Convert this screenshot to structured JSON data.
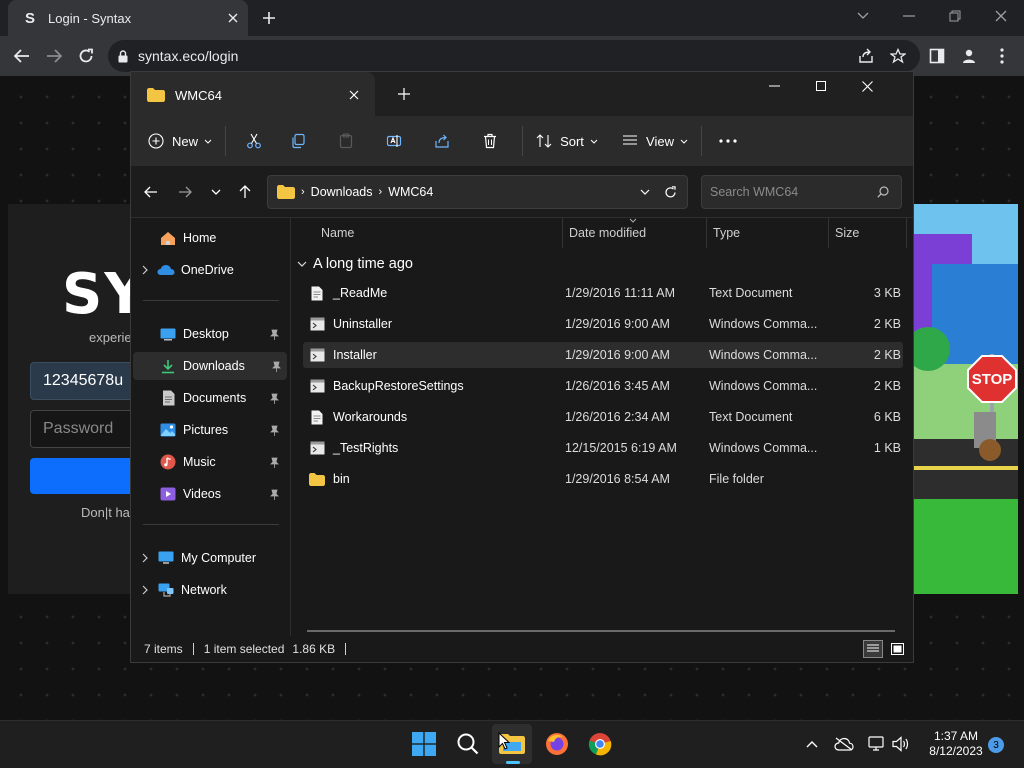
{
  "browser": {
    "tab_title": "Login - Syntax",
    "tab_favicon": "S",
    "url": "syntax.eco/login"
  },
  "login_page": {
    "logo_partial": "SY",
    "subtitle_partial": "experie",
    "username_value": "12345678u",
    "password_placeholder": "Password",
    "signup_partial": "Don|t ha"
  },
  "explorer": {
    "tab_title": "WMC64",
    "toolbar": {
      "new_label": "New",
      "sort_label": "Sort",
      "view_label": "View"
    },
    "breadcrumb": [
      "Downloads",
      "WMC64"
    ],
    "search_placeholder": "Search WMC64",
    "nav_items": [
      {
        "label": "Home",
        "icon": "home-icon"
      },
      {
        "label": "OneDrive",
        "icon": "onedrive-icon"
      },
      {
        "label": "Desktop",
        "icon": "desktop-icon",
        "pinned": true
      },
      {
        "label": "Downloads",
        "icon": "downloads-icon",
        "pinned": true,
        "selected": true
      },
      {
        "label": "Documents",
        "icon": "documents-icon",
        "pinned": true
      },
      {
        "label": "Pictures",
        "icon": "pictures-icon",
        "pinned": true
      },
      {
        "label": "Music",
        "icon": "music-icon",
        "pinned": true
      },
      {
        "label": "Videos",
        "icon": "videos-icon",
        "pinned": true
      },
      {
        "label": "My Computer",
        "icon": "computer-icon"
      },
      {
        "label": "Network",
        "icon": "network-icon"
      }
    ],
    "columns": [
      "Name",
      "Date modified",
      "Type",
      "Size"
    ],
    "group_label": "A long time ago",
    "files": [
      {
        "name": "_ReadMe",
        "date": "1/29/2016 11:11 AM",
        "type": "Text Document",
        "size": "3 KB",
        "icon": "text-file-icon"
      },
      {
        "name": "Uninstaller",
        "date": "1/29/2016 9:00 AM",
        "type": "Windows Comma...",
        "size": "2 KB",
        "icon": "command-script-icon"
      },
      {
        "name": "Installer",
        "date": "1/29/2016 9:00 AM",
        "type": "Windows Comma...",
        "size": "2 KB",
        "icon": "command-script-icon",
        "selected": true
      },
      {
        "name": "BackupRestoreSettings",
        "date": "1/26/2016 3:45 AM",
        "type": "Windows Comma...",
        "size": "2 KB",
        "icon": "command-script-icon"
      },
      {
        "name": "Workarounds",
        "date": "1/26/2016 2:34 AM",
        "type": "Text Document",
        "size": "6 KB",
        "icon": "text-file-icon"
      },
      {
        "name": "_TestRights",
        "date": "12/15/2015 6:19 AM",
        "type": "Windows Comma...",
        "size": "1 KB",
        "icon": "command-script-icon"
      },
      {
        "name": "bin",
        "date": "1/29/2016 8:54 AM",
        "type": "File folder",
        "size": "",
        "icon": "folder-icon"
      }
    ],
    "status": {
      "items": "7 items",
      "selected": "1 item selected",
      "size": "1.86 KB"
    }
  },
  "taskbar": {
    "time": "1:37 AM",
    "date": "8/12/2023",
    "notification_count": "3"
  },
  "colors": {
    "chrome_bg": "#202124",
    "explorer_bg": "#191919",
    "accent_blue": "#0d6efd",
    "folder_yellow": "#f4c542"
  }
}
